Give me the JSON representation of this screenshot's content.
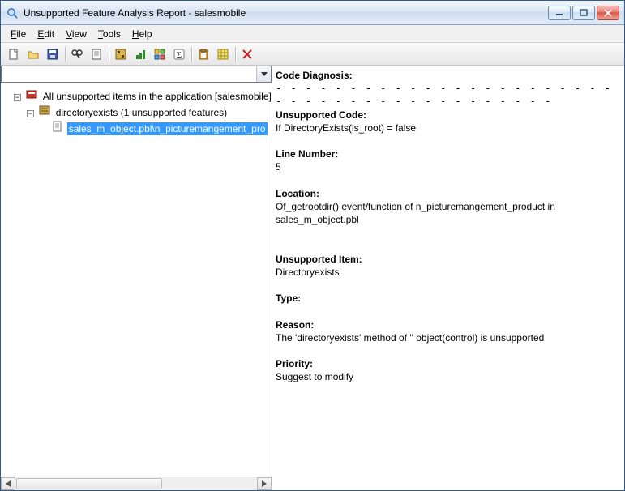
{
  "window": {
    "title": "Unsupported Feature Analysis Report - salesmobile"
  },
  "menubar": {
    "items": [
      "File",
      "Edit",
      "View",
      "Tools",
      "Help"
    ]
  },
  "toolbar": {
    "icons": [
      "new-icon",
      "open-icon",
      "save-icon",
      "|",
      "find-icon",
      "report-icon",
      "|",
      "analyze-icon",
      "chart-icon",
      "matrix-icon",
      "sigma-icon",
      "|",
      "clipboard-icon",
      "grid-icon",
      "|",
      "delete-icon"
    ]
  },
  "tree": {
    "root_label": "All unsupported items in the application [salesmobile] (",
    "node1_label": "directoryexists (1 unsupported features)",
    "leaf_label": "sales_m_object.pbl\\n_picturemangement_pro"
  },
  "detail": {
    "diag_label": "Code Diagnosis:",
    "dashes": "- - - - - - - - - - - - - - - - - - - - - - - - - - - - - - - - - - - - - - - - - -",
    "unsup_code_label": "Unsupported Code:",
    "unsup_code_value": "If DirectoryExists(ls_root) = false",
    "line_label": "Line Number:",
    "line_value": "5",
    "loc_label": "Location:",
    "loc_value": "Of_getrootdir() event/function of n_picturemangement_product in sales_m_object.pbl",
    "item_label": "Unsupported Item:",
    "item_value": "Directoryexists",
    "type_label": "Type:",
    "type_value": "",
    "reason_label": "Reason:",
    "reason_value": "The 'directoryexists' method of '' object(control) is unsupported",
    "priority_label": "Priority:",
    "priority_value": "Suggest to modify"
  }
}
